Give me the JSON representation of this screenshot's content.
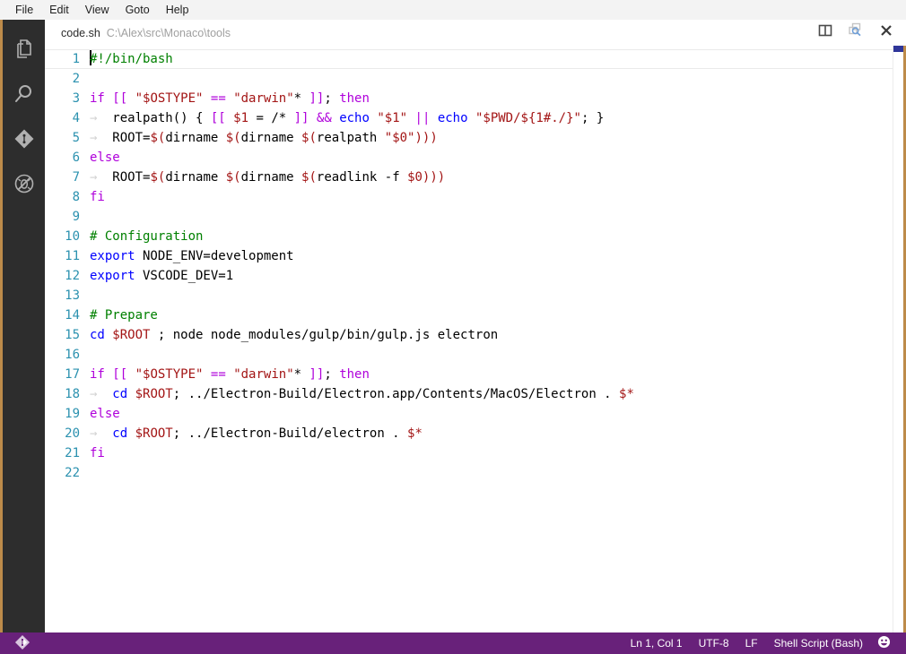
{
  "menubar": {
    "items": [
      {
        "label": "File",
        "name": "menu-file"
      },
      {
        "label": "Edit",
        "name": "menu-edit"
      },
      {
        "label": "View",
        "name": "menu-view"
      },
      {
        "label": "Goto",
        "name": "menu-goto"
      },
      {
        "label": "Help",
        "name": "menu-help"
      }
    ]
  },
  "activitybar": {
    "items": [
      {
        "icon": "files-explorer-icon",
        "name": "activitybar-item-explorer"
      },
      {
        "icon": "search-icon",
        "name": "activitybar-item-search"
      },
      {
        "icon": "source-control-icon",
        "name": "activitybar-item-source-control"
      },
      {
        "icon": "no-debug-icon",
        "name": "activitybar-item-debug"
      }
    ]
  },
  "editor": {
    "file_name": "code.sh",
    "file_path": "C:\\Alex\\src\\Monaco\\tools",
    "actions": [
      {
        "icon": "split-editor-icon",
        "name": "split-editor-button"
      },
      {
        "icon": "peek-references-icon",
        "name": "peek-references-button"
      },
      {
        "icon": "close-icon",
        "name": "close-editor-button"
      }
    ],
    "language": "Shell Script (Bash)",
    "cursor_line": 1,
    "cursor_column": 1,
    "lines": [
      {
        "n": "1",
        "cursor": true,
        "current": true,
        "tokens": [
          {
            "c": "t-cmt",
            "t": "#!/bin/bash"
          }
        ]
      },
      {
        "n": "2",
        "tokens": []
      },
      {
        "n": "3",
        "tokens": [
          {
            "c": "t-kw",
            "t": "if"
          },
          {
            "c": "t-plain",
            "t": " "
          },
          {
            "c": "t-kw",
            "t": "[["
          },
          {
            "c": "t-plain",
            "t": " "
          },
          {
            "c": "t-str",
            "t": "\"$OSTYPE\""
          },
          {
            "c": "t-plain",
            "t": " "
          },
          {
            "c": "t-kw",
            "t": "=="
          },
          {
            "c": "t-plain",
            "t": " "
          },
          {
            "c": "t-str",
            "t": "\"darwin\""
          },
          {
            "c": "t-plain",
            "t": "* "
          },
          {
            "c": "t-kw",
            "t": "]]"
          },
          {
            "c": "t-plain",
            "t": "; "
          },
          {
            "c": "t-kw",
            "t": "then"
          }
        ]
      },
      {
        "n": "4",
        "tab": true,
        "tokens": [
          {
            "c": "t-plain",
            "t": "  realpath() { "
          },
          {
            "c": "t-kw",
            "t": "[["
          },
          {
            "c": "t-plain",
            "t": " "
          },
          {
            "c": "t-var",
            "t": "$1"
          },
          {
            "c": "t-plain",
            "t": " = /* "
          },
          {
            "c": "t-kw",
            "t": "]]"
          },
          {
            "c": "t-plain",
            "t": " "
          },
          {
            "c": "t-kw",
            "t": "&&"
          },
          {
            "c": "t-plain",
            "t": " "
          },
          {
            "c": "t-cmd",
            "t": "echo"
          },
          {
            "c": "t-plain",
            "t": " "
          },
          {
            "c": "t-str",
            "t": "\"$1\""
          },
          {
            "c": "t-plain",
            "t": " "
          },
          {
            "c": "t-kw",
            "t": "||"
          },
          {
            "c": "t-plain",
            "t": " "
          },
          {
            "c": "t-cmd",
            "t": "echo"
          },
          {
            "c": "t-plain",
            "t": " "
          },
          {
            "c": "t-str",
            "t": "\"$PWD/${1#./}\""
          },
          {
            "c": "t-plain",
            "t": "; }"
          }
        ]
      },
      {
        "n": "5",
        "tab": true,
        "tokens": [
          {
            "c": "t-plain",
            "t": "  ROOT="
          },
          {
            "c": "t-var",
            "t": "$("
          },
          {
            "c": "t-plain",
            "t": "dirname "
          },
          {
            "c": "t-var",
            "t": "$("
          },
          {
            "c": "t-plain",
            "t": "dirname "
          },
          {
            "c": "t-var",
            "t": "$("
          },
          {
            "c": "t-plain",
            "t": "realpath "
          },
          {
            "c": "t-str",
            "t": "\"$0\""
          },
          {
            "c": "t-var",
            "t": ")))"
          }
        ]
      },
      {
        "n": "6",
        "tokens": [
          {
            "c": "t-kw",
            "t": "else"
          }
        ]
      },
      {
        "n": "7",
        "tab": true,
        "tokens": [
          {
            "c": "t-plain",
            "t": "  ROOT="
          },
          {
            "c": "t-var",
            "t": "$("
          },
          {
            "c": "t-plain",
            "t": "dirname "
          },
          {
            "c": "t-var",
            "t": "$("
          },
          {
            "c": "t-plain",
            "t": "dirname "
          },
          {
            "c": "t-var",
            "t": "$("
          },
          {
            "c": "t-plain",
            "t": "readlink -f "
          },
          {
            "c": "t-var",
            "t": "$0"
          },
          {
            "c": "t-var",
            "t": ")))"
          }
        ]
      },
      {
        "n": "8",
        "tokens": [
          {
            "c": "t-kw",
            "t": "fi"
          }
        ]
      },
      {
        "n": "9",
        "tokens": []
      },
      {
        "n": "10",
        "tokens": [
          {
            "c": "t-cmt",
            "t": "# Configuration"
          }
        ]
      },
      {
        "n": "11",
        "tokens": [
          {
            "c": "t-cmd",
            "t": "export"
          },
          {
            "c": "t-plain",
            "t": " NODE_ENV=development"
          }
        ]
      },
      {
        "n": "12",
        "tokens": [
          {
            "c": "t-cmd",
            "t": "export"
          },
          {
            "c": "t-plain",
            "t": " VSCODE_DEV=1"
          }
        ]
      },
      {
        "n": "13",
        "tokens": []
      },
      {
        "n": "14",
        "tokens": [
          {
            "c": "t-cmt",
            "t": "# Prepare"
          }
        ]
      },
      {
        "n": "15",
        "tokens": [
          {
            "c": "t-cmd",
            "t": "cd"
          },
          {
            "c": "t-plain",
            "t": " "
          },
          {
            "c": "t-var",
            "t": "$ROOT"
          },
          {
            "c": "t-plain",
            "t": " ; node node_modules/gulp/bin/gulp.js electron"
          }
        ]
      },
      {
        "n": "16",
        "tokens": []
      },
      {
        "n": "17",
        "tokens": [
          {
            "c": "t-kw",
            "t": "if"
          },
          {
            "c": "t-plain",
            "t": " "
          },
          {
            "c": "t-kw",
            "t": "[["
          },
          {
            "c": "t-plain",
            "t": " "
          },
          {
            "c": "t-str",
            "t": "\"$OSTYPE\""
          },
          {
            "c": "t-plain",
            "t": " "
          },
          {
            "c": "t-kw",
            "t": "=="
          },
          {
            "c": "t-plain",
            "t": " "
          },
          {
            "c": "t-str",
            "t": "\"darwin\""
          },
          {
            "c": "t-plain",
            "t": "* "
          },
          {
            "c": "t-kw",
            "t": "]]"
          },
          {
            "c": "t-plain",
            "t": "; "
          },
          {
            "c": "t-kw",
            "t": "then"
          }
        ]
      },
      {
        "n": "18",
        "tab": true,
        "tokens": [
          {
            "c": "t-plain",
            "t": "  "
          },
          {
            "c": "t-cmd",
            "t": "cd"
          },
          {
            "c": "t-plain",
            "t": " "
          },
          {
            "c": "t-var",
            "t": "$ROOT"
          },
          {
            "c": "t-plain",
            "t": "; ../Electron-Build/Electron.app/Contents/MacOS/Electron . "
          },
          {
            "c": "t-var",
            "t": "$*"
          }
        ]
      },
      {
        "n": "19",
        "tokens": [
          {
            "c": "t-kw",
            "t": "else"
          }
        ]
      },
      {
        "n": "20",
        "tab": true,
        "tokens": [
          {
            "c": "t-plain",
            "t": "  "
          },
          {
            "c": "t-cmd",
            "t": "cd"
          },
          {
            "c": "t-plain",
            "t": " "
          },
          {
            "c": "t-var",
            "t": "$ROOT"
          },
          {
            "c": "t-plain",
            "t": "; ../Electron-Build/electron . "
          },
          {
            "c": "t-var",
            "t": "$*"
          }
        ]
      },
      {
        "n": "21",
        "tokens": [
          {
            "c": "t-kw",
            "t": "fi"
          }
        ]
      },
      {
        "n": "22",
        "tokens": []
      }
    ]
  },
  "statusbar": {
    "source_control_icon": "source-control-icon",
    "position": "Ln 1, Col 1",
    "encoding": "UTF-8",
    "eol": "LF",
    "language": "Shell Script (Bash)",
    "feedback_icon": "smiley-icon",
    "background": "#68217a"
  },
  "colors": {
    "accent_border": "#bd8b4a",
    "activitybar_bg": "#2d2d2d",
    "statusbar_bg": "#68217a",
    "menubar_bg": "#f3f3f3",
    "linenumber": "#2b91af",
    "comment": "#008000",
    "keyword": "#af00db",
    "command": "#0000ff",
    "string": "#a31515",
    "scrollbar_thumb": "#2f3699"
  }
}
